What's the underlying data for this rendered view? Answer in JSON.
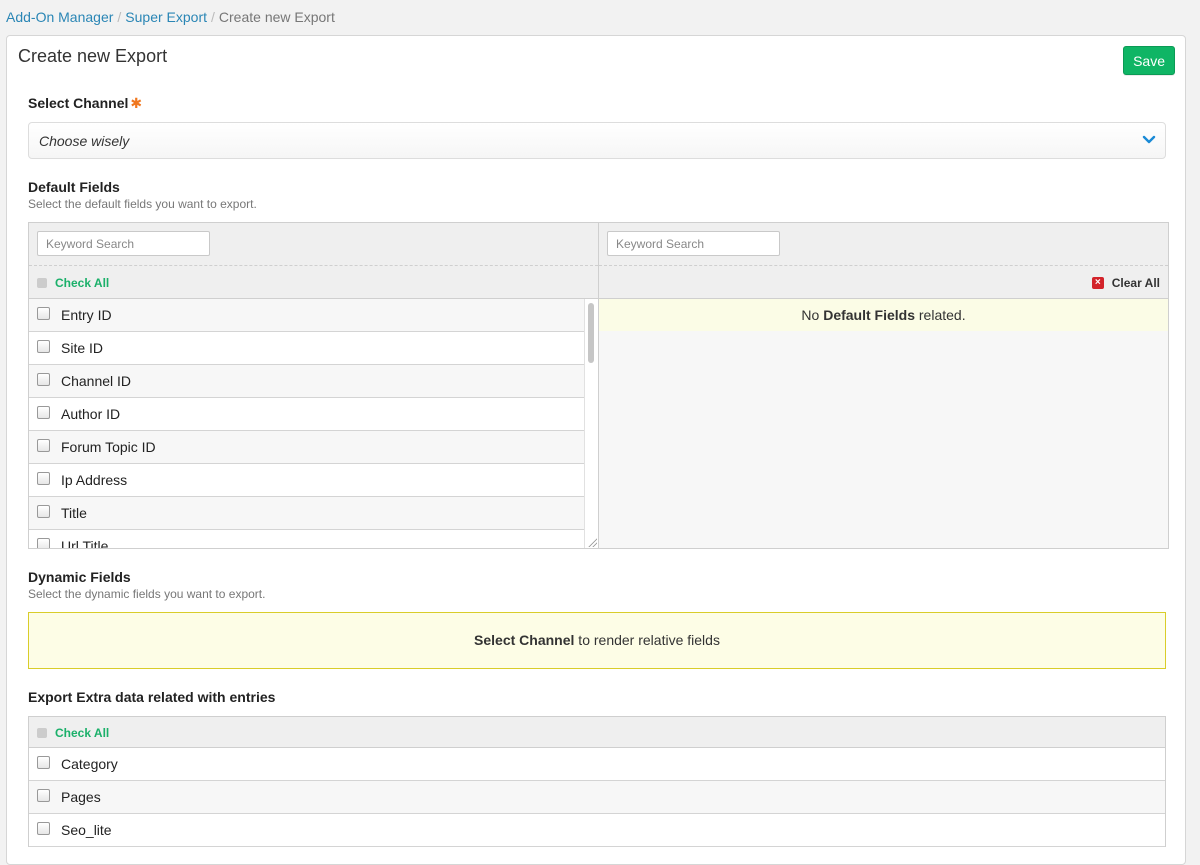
{
  "breadcrumb": {
    "items": [
      "Add-On Manager",
      "Super Export"
    ],
    "current": "Create new Export"
  },
  "page": {
    "title": "Create new Export",
    "save_label": "Save"
  },
  "channel": {
    "label": "Select Channel",
    "required_mark": "✱",
    "selected": "Choose wisely"
  },
  "default_fields": {
    "label": "Default Fields",
    "hint": "Select the default fields you want to export.",
    "search_placeholder_left": "Keyword Search",
    "search_placeholder_right": "Keyword Search",
    "check_all_label": "Check All",
    "clear_all_label": "Clear All",
    "empty_prefix": "No ",
    "empty_bold": "Default Fields",
    "empty_suffix": " related.",
    "items": [
      "Entry ID",
      "Site ID",
      "Channel ID",
      "Author ID",
      "Forum Topic ID",
      "Ip Address",
      "Title",
      "Url Title"
    ]
  },
  "dynamic_fields": {
    "label": "Dynamic Fields",
    "hint": "Select the dynamic fields you want to export.",
    "notice_bold": "Select Channel",
    "notice_rest": " to render relative fields"
  },
  "extra_data": {
    "label": "Export Extra data related with entries",
    "check_all_label": "Check All",
    "items": [
      "Category",
      "Pages",
      "Seo_lite"
    ]
  },
  "colors": {
    "link": "#2a86b5",
    "save": "#0fb565",
    "check_all": "#1bb06a",
    "required": "#f0771f",
    "clear_icon": "#d3232a",
    "notice_border": "#d9cd2a"
  }
}
